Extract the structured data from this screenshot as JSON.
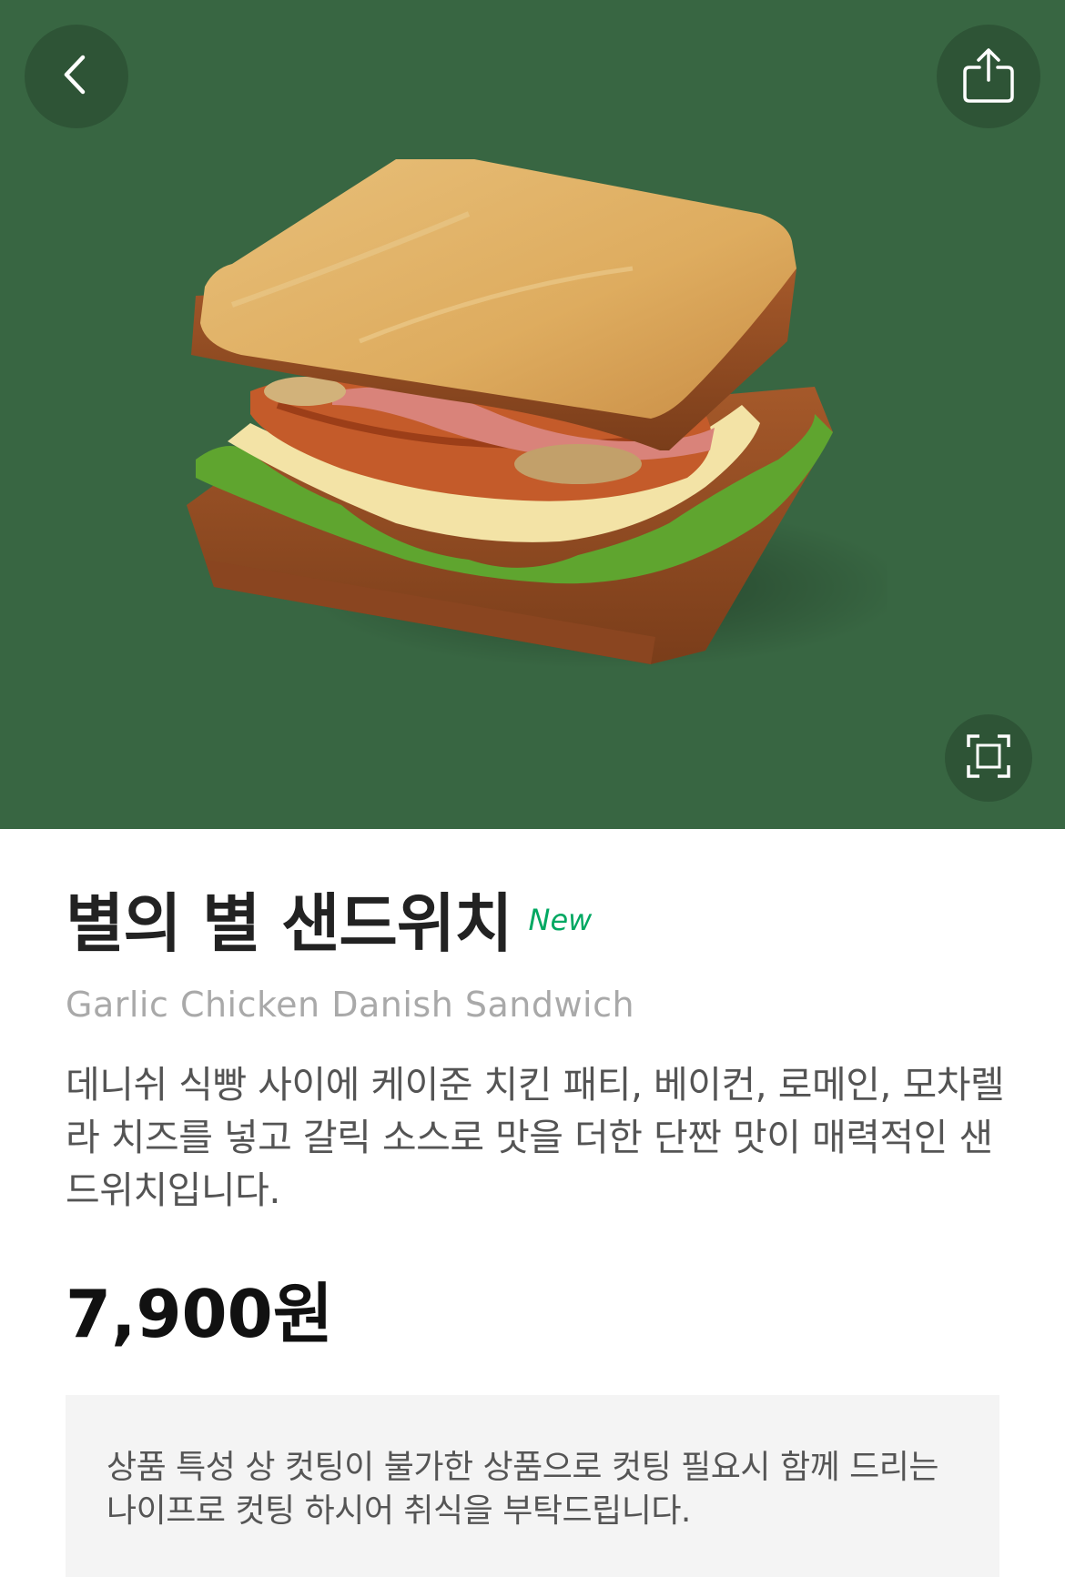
{
  "header": {
    "back_icon": "chevron-left-icon",
    "share_icon": "share-icon",
    "zoom_icon": "fullscreen-frame-icon",
    "background_color": "#386642"
  },
  "product": {
    "image_subject": "sandwich",
    "title": "별의 별 샌드위치",
    "badge": "New",
    "english_name": "Garlic Chicken Danish Sandwich",
    "description": "데니쉬 식빵 사이에 케이준 치킨 패티, 베이컨, 로메인, 모차렐라 치즈를 넣고 갈릭 소스로 맛을 더한 단짠 맛이 매력적인 샌드위치입니다.",
    "price": "7,900원",
    "notice": "상품 특성 상 컷팅이 불가한 상품으로 컷팅 필요시 함께 드리는 나이프로 컷팅 하시어 취식을 부탁드립니다."
  },
  "colors": {
    "accent": "#00a862",
    "hero_bg": "#386642"
  }
}
